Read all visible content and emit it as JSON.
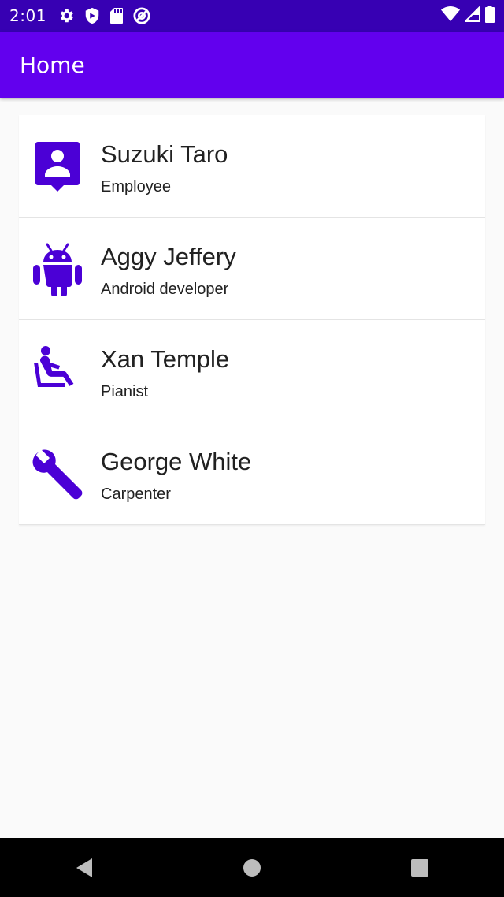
{
  "status_bar": {
    "time": "2:01",
    "left_icons": [
      "gear-icon",
      "shield-icon",
      "sd-card-icon",
      "at-sign-icon"
    ],
    "right_icons": [
      "wifi-icon",
      "signal-icon",
      "battery-icon"
    ]
  },
  "app_bar": {
    "title": "Home",
    "color": "#6200ee"
  },
  "people": [
    {
      "name": "Suzuki Taro",
      "role": "Employee",
      "icon": "contact-card-icon"
    },
    {
      "name": "Aggy Jeffery",
      "role": "Android developer",
      "icon": "android-icon"
    },
    {
      "name": "Xan Temple",
      "role": "Pianist",
      "icon": "seated-person-icon"
    },
    {
      "name": "George White",
      "role": "Carpenter",
      "icon": "wrench-icon"
    }
  ],
  "nav_bar": {
    "buttons": [
      "back-icon",
      "home-icon",
      "recents-icon"
    ]
  },
  "colors": {
    "accent": "#6200ee",
    "status_bar": "#3700b3",
    "icon": "#4b00d6"
  }
}
